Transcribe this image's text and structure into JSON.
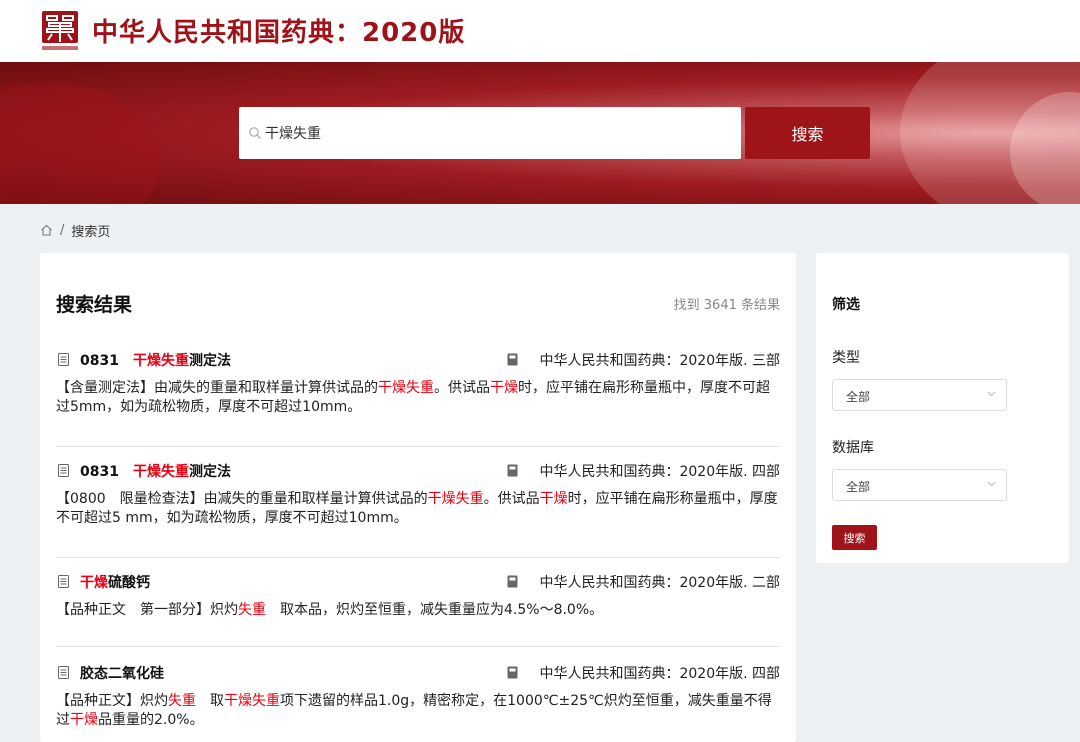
{
  "header": {
    "site_title": "中华人民共和国药典：2020版",
    "logo_icon": "pharmacopoeia-seal-logo-icon"
  },
  "search": {
    "query": "干燥失重",
    "button_label": "搜索",
    "icon": "search-icon"
  },
  "breadcrumb": {
    "home_icon": "home-icon",
    "separator": "/",
    "current": "搜索页"
  },
  "results": {
    "title": "搜索结果",
    "count_text": "找到 3641 条结果",
    "items": [
      {
        "title_parts": [
          {
            "text": "0831",
            "hl": false,
            "num": true
          },
          {
            "text": "干燥失重",
            "hl": true
          },
          {
            "text": "测定法",
            "hl": false
          }
        ],
        "source": "中华人民共和国药典：2020年版. 三部",
        "desc_parts": [
          {
            "text": "【含量测定法】由减失的重量和取样量计算供试品的",
            "hl": false
          },
          {
            "text": "干燥失重",
            "hl": true
          },
          {
            "text": "。供试品",
            "hl": false
          },
          {
            "text": "干燥",
            "hl": true
          },
          {
            "text": "时，应平铺在扁形称量瓶中，厚度不可超过5mm，如为疏松物质，厚度不可超过10mm。",
            "hl": false
          }
        ]
      },
      {
        "title_parts": [
          {
            "text": "0831",
            "hl": false,
            "num": true
          },
          {
            "text": "干燥失重",
            "hl": true
          },
          {
            "text": "测定法",
            "hl": false
          }
        ],
        "source": "中华人民共和国药典：2020年版. 四部",
        "desc_parts": [
          {
            "text": "【0800　限量检查法】由减失的重量和取样量计算供试品的",
            "hl": false
          },
          {
            "text": "干燥失重",
            "hl": true
          },
          {
            "text": "。供试品",
            "hl": false
          },
          {
            "text": "干燥",
            "hl": true
          },
          {
            "text": "时，应平铺在扁形称量瓶中，厚度不可超过5 mm，如为疏松物质，厚度不可超过10mm。",
            "hl": false
          }
        ]
      },
      {
        "title_parts": [
          {
            "text": "干燥",
            "hl": true
          },
          {
            "text": "硫酸钙",
            "hl": false
          }
        ],
        "source": "中华人民共和国药典：2020年版. 二部",
        "desc_parts": [
          {
            "text": "【品种正文　第一部分】炽灼",
            "hl": false
          },
          {
            "text": "失重",
            "hl": true
          },
          {
            "text": "　取本品，炽灼至恒重，减失重量应为4.5%～8.0%。",
            "hl": false
          }
        ]
      },
      {
        "title_parts": [
          {
            "text": "胶态二氧化硅",
            "hl": false
          }
        ],
        "source": "中华人民共和国药典：2020年版. 四部",
        "desc_parts": [
          {
            "text": "【品种正文】炽灼",
            "hl": false
          },
          {
            "text": "失重",
            "hl": true
          },
          {
            "text": "　取",
            "hl": false
          },
          {
            "text": "干燥失重",
            "hl": true
          },
          {
            "text": "项下遗留的样品1.0g，精密称定，在1000℃±25℃炽灼至恒重，减失重量不得过",
            "hl": false
          },
          {
            "text": "干燥",
            "hl": true
          },
          {
            "text": "品重量的2.0%。",
            "hl": false
          }
        ]
      }
    ]
  },
  "filter": {
    "title": "筛选",
    "type_label": "类型",
    "type_value": "全部",
    "db_label": "数据库",
    "db_value": "全部",
    "button_label": "搜索"
  },
  "colors": {
    "brand_red": "#9f1419",
    "highlight": "#e60012"
  }
}
